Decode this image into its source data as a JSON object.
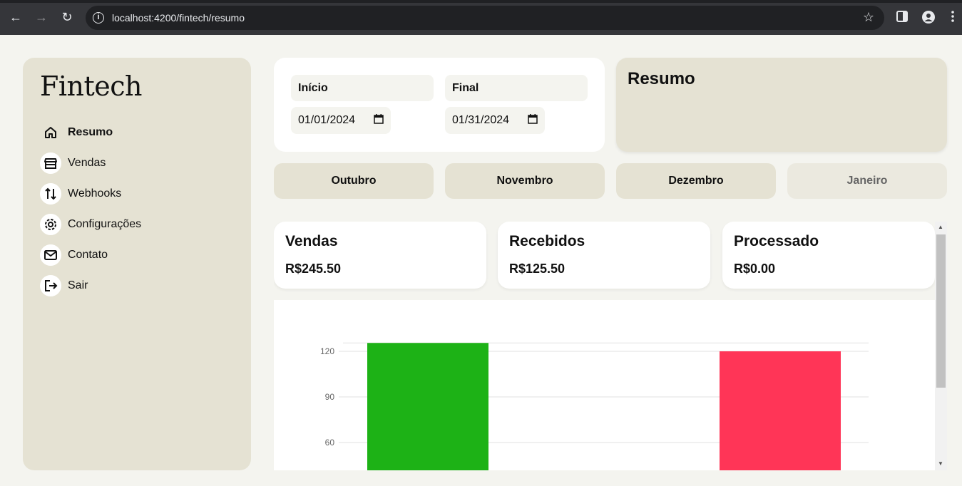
{
  "browser": {
    "url": "localhost:4200/fintech/resumo"
  },
  "sidebar": {
    "logo": "Fintech",
    "items": [
      {
        "label": "Resumo",
        "icon": "home-icon",
        "active": true
      },
      {
        "label": "Vendas",
        "icon": "store-icon"
      },
      {
        "label": "Webhooks",
        "icon": "arrows-updown-icon"
      },
      {
        "label": "Configurações",
        "icon": "gear-icon"
      },
      {
        "label": "Contato",
        "icon": "mail-icon"
      },
      {
        "label": "Sair",
        "icon": "logout-icon"
      }
    ]
  },
  "dates": {
    "start_label": "Início",
    "start_value": "01/01/2024",
    "end_label": "Final",
    "end_value": "01/31/2024"
  },
  "resumo": {
    "title": "Resumo"
  },
  "months": [
    {
      "label": "Outubro"
    },
    {
      "label": "Novembro"
    },
    {
      "label": "Dezembro"
    },
    {
      "label": "Janeiro",
      "current": true
    }
  ],
  "stats": [
    {
      "title": "Vendas",
      "value": "R$245.50"
    },
    {
      "title": "Recebidos",
      "value": "R$125.50"
    },
    {
      "title": "Processado",
      "value": "R$0.00"
    }
  ],
  "colors": {
    "bar_green": "#1db216",
    "bar_red": "#ff3557",
    "panel_beige": "#e5e2d3",
    "background": "#f4f4ef"
  },
  "chart_data": {
    "type": "bar",
    "y_ticks": [
      "120",
      "90",
      "60"
    ],
    "ylim": [
      60,
      130
    ],
    "values": [
      125.5,
      120
    ]
  }
}
